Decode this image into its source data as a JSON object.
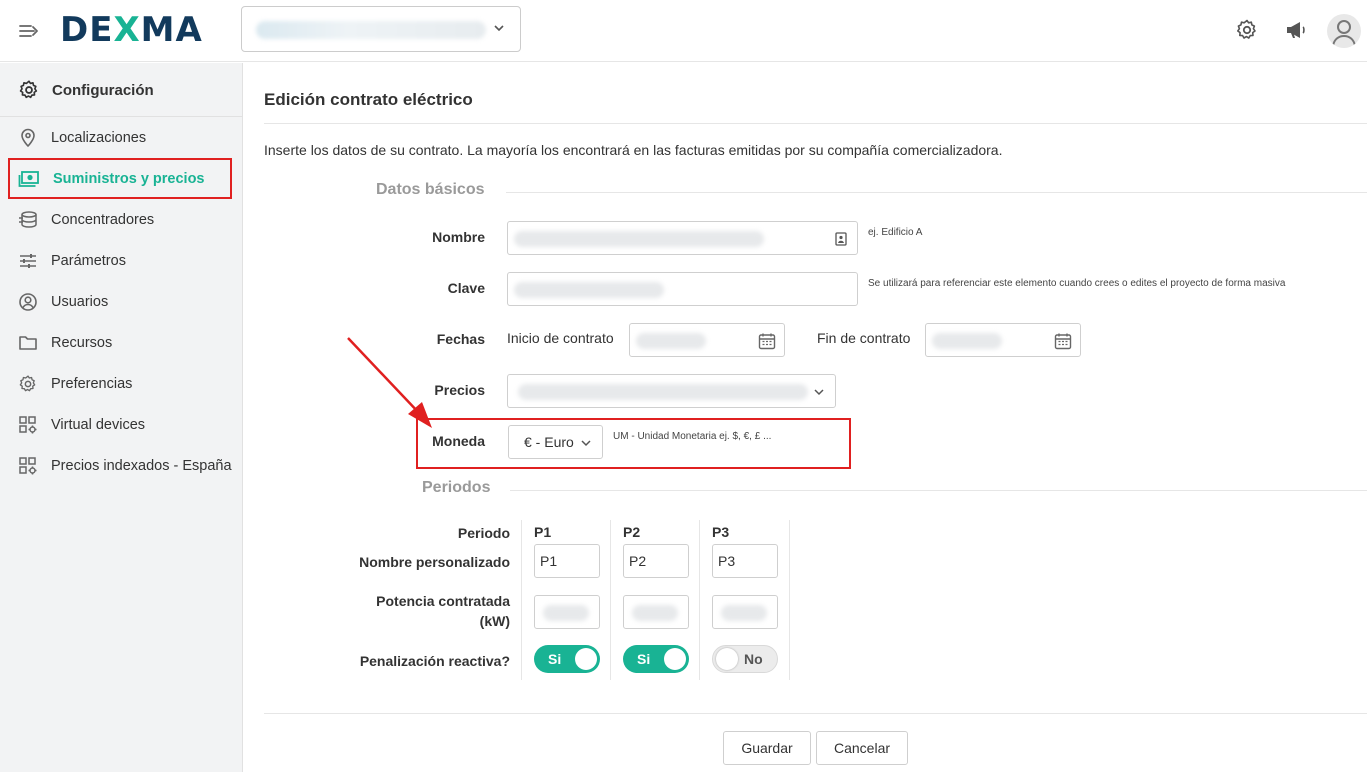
{
  "header": {
    "logo_prefix": "DE",
    "logo_x": "X",
    "logo_suffix": "MA",
    "icons": [
      "menu-expand-icon",
      "chevron-down-icon",
      "gear-icon",
      "megaphone-icon",
      "user-avatar-icon"
    ]
  },
  "sidebar": {
    "title": "Configuración",
    "items": [
      {
        "label": "Localizaciones",
        "icon": "location-pin-icon"
      },
      {
        "label": "Suministros y precios",
        "icon": "money-icon",
        "active": true
      },
      {
        "label": "Concentradores",
        "icon": "database-icon"
      },
      {
        "label": "Parámetros",
        "icon": "sliders-icon"
      },
      {
        "label": "Usuarios",
        "icon": "user-circle-icon"
      },
      {
        "label": "Recursos",
        "icon": "folder-icon"
      },
      {
        "label": "Preferencias",
        "icon": "gear-icon"
      },
      {
        "label": "Virtual devices",
        "icon": "grid-gear-icon"
      },
      {
        "label": "Precios indexados - España",
        "icon": "grid-gear-icon"
      }
    ]
  },
  "main": {
    "title": "Edición contrato eléctrico",
    "intro": "Inserte los datos de su contrato. La mayoría los encontrará en las facturas emitidas por su compañía comercializadora.",
    "basic_section": "Datos básicos",
    "nombre_label": "Nombre",
    "nombre_hint": "ej. Edificio A",
    "clave_label": "Clave",
    "clave_hint": "Se utilizará para referenciar este elemento cuando crees o edites el proyecto de forma masiva",
    "fechas_label": "Fechas",
    "inicio_label": "Inicio de contrato",
    "fin_label": "Fin de contrato",
    "precios_label": "Precios",
    "moneda_label": "Moneda",
    "moneda_value": "€ - Euro",
    "moneda_hint": "UM - Unidad Monetaria ej. $, €, £ ...",
    "periods_section": "Periodos"
  },
  "periods": {
    "periodo_label": "Periodo",
    "nombre_label": "Nombre personalizado",
    "potencia_label_1": "Potencia contratada",
    "potencia_label_2": "(kW)",
    "penalizacion_label": "Penalización reactiva?",
    "columns": [
      {
        "head": "P1",
        "name": "P1",
        "reactive": "Si",
        "reactive_on": true
      },
      {
        "head": "P2",
        "name": "P2",
        "reactive": "Si",
        "reactive_on": true
      },
      {
        "head": "P3",
        "name": "P3",
        "reactive": "No",
        "reactive_on": false
      }
    ]
  },
  "actions": {
    "save_label": "Guardar",
    "cancel_label": "Cancelar"
  },
  "colors": {
    "brand_navy": "#123a5c",
    "accent_green": "#19b394",
    "annotation_red": "#e02020"
  }
}
